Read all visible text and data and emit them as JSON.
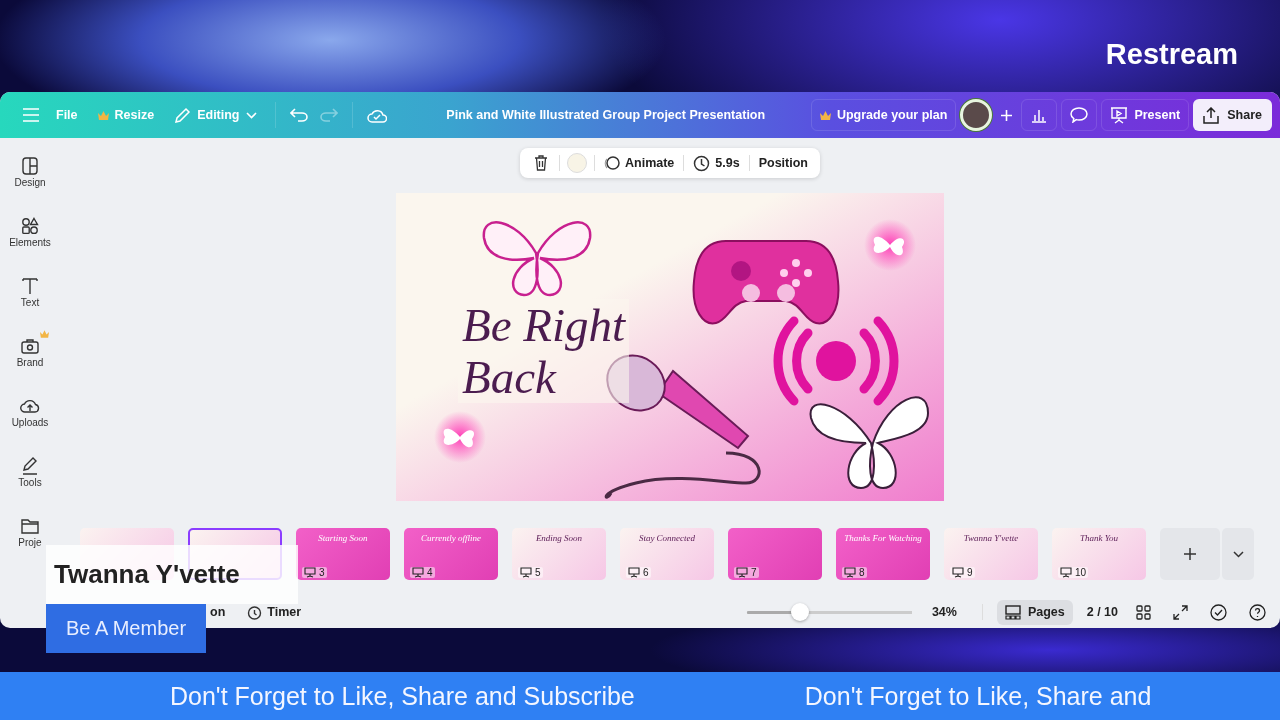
{
  "brand": {
    "logo": "Restream"
  },
  "topbar": {
    "menu": [
      {
        "label": "File",
        "kind": "plain"
      },
      {
        "label": "Resize",
        "kind": "crown"
      },
      {
        "label": "Editing",
        "kind": "pencil"
      }
    ],
    "title": "Pink and White Illustrated Group Project Presentation",
    "upgrade": "Upgrade your plan",
    "present": "Present",
    "share": "Share"
  },
  "sidebar": {
    "items": [
      {
        "label": "Design",
        "kind": "design",
        "premium": false
      },
      {
        "label": "Elements",
        "kind": "elements",
        "premium": false
      },
      {
        "label": "Text",
        "kind": "text",
        "premium": false
      },
      {
        "label": "Brand",
        "kind": "brand",
        "premium": true
      },
      {
        "label": "Uploads",
        "kind": "uploads",
        "premium": false
      },
      {
        "label": "Tools",
        "kind": "tools",
        "premium": false
      },
      {
        "label": "Proje",
        "kind": "projects",
        "premium": false
      }
    ]
  },
  "toolbar": {
    "animate": "Animate",
    "duration": "5.9s",
    "position": "Position"
  },
  "slide": {
    "lines": [
      "Be Right",
      "Back"
    ]
  },
  "pages": [
    {
      "selected": false,
      "kind": "light"
    },
    {
      "selected": true,
      "kind": "light"
    },
    {
      "selected": false,
      "kind": "pink",
      "number": "3",
      "title": "Starting Soon"
    },
    {
      "selected": false,
      "kind": "pink",
      "number": "4",
      "title": "Currently offline"
    },
    {
      "selected": false,
      "kind": "light",
      "number": "5",
      "title": "Ending Soon"
    },
    {
      "selected": false,
      "kind": "light",
      "number": "6",
      "title": "Stay Connected"
    },
    {
      "selected": false,
      "kind": "pink",
      "number": "7"
    },
    {
      "selected": false,
      "kind": "pink",
      "number": "8",
      "title": "Thanks For Watching"
    },
    {
      "selected": false,
      "kind": "light",
      "number": "9",
      "title": "Twanna Y'vette"
    },
    {
      "selected": false,
      "kind": "light",
      "number": "10",
      "title": "Thank You"
    }
  ],
  "footer": {
    "duration_fragment": "on",
    "timer": "Timer",
    "zoom": {
      "level": 0.32,
      "reading": "34%"
    },
    "pages_button": "Pages",
    "page_count": "2 / 10"
  },
  "overlay": {
    "name": "Twanna Y'vette",
    "cta": "Be A Member"
  },
  "ticker": [
    "Don't Forget to Like, Share and Subscribe",
    "Don't Forget to Like, Share and"
  ]
}
